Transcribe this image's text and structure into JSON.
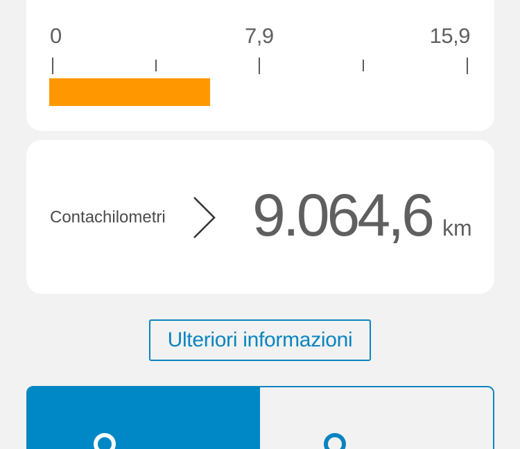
{
  "gauge": {
    "scale_min_label": "0",
    "scale_mid_label": "7,9",
    "scale_max_label": "15,9",
    "scale_max_value": 15.9,
    "current_value": 6.1,
    "bar_color": "#ff9800"
  },
  "odometer": {
    "label": "Contachilometri",
    "value": "9.064,6",
    "unit": "km",
    "chevron_icon": "chevron-right-icon"
  },
  "more_info": {
    "label": "Ulteriori informazioni"
  },
  "segmented_control": {
    "accent_color": "#0088c6",
    "left_icon": "person-icon",
    "right_icon": "person-icon",
    "selected": "left"
  }
}
